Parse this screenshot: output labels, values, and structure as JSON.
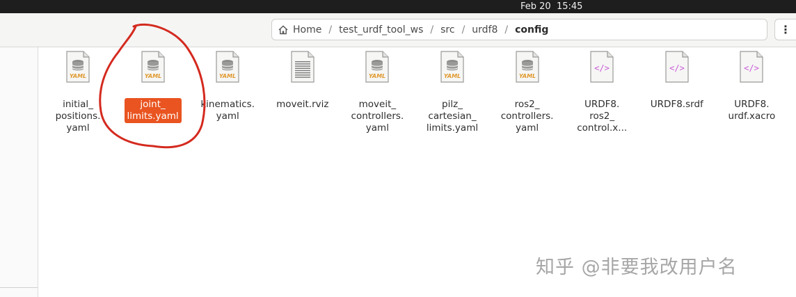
{
  "topbar": {
    "clock": "Feb 20  15:45"
  },
  "pathbar": {
    "home": "Home",
    "crumbs": [
      "test_urdf_tool_ws",
      "src",
      "urdf8"
    ],
    "current": "config",
    "separator": "/"
  },
  "menu": {
    "icon": "⋮"
  },
  "files": [
    {
      "label": "initial_\npositions.\nyaml",
      "type": "yaml"
    },
    {
      "label": "joint_\nlimits.yaml",
      "type": "yaml",
      "selected": true
    },
    {
      "label": "kinematics.\nyaml",
      "type": "yaml"
    },
    {
      "label": "moveit.rviz",
      "type": "text"
    },
    {
      "label": "moveit_\ncontrollers.\nyaml",
      "type": "yaml"
    },
    {
      "label": "pilz_\ncartesian_\nlimits.yaml",
      "type": "yaml"
    },
    {
      "label": "ros2_\ncontrollers.\nyaml",
      "type": "yaml"
    },
    {
      "label": "URDF8.\nros2_\ncontrol.x...",
      "type": "xml"
    },
    {
      "label": "URDF8.srdf",
      "type": "xml"
    },
    {
      "label": "URDF8.\nurdf.xacro",
      "type": "xml"
    }
  ],
  "watermark": "知乎 @非要我改用户名",
  "colors": {
    "selection": "#e95420",
    "annotation": "#d42a1f",
    "xml_tag": "#c95bd6"
  }
}
